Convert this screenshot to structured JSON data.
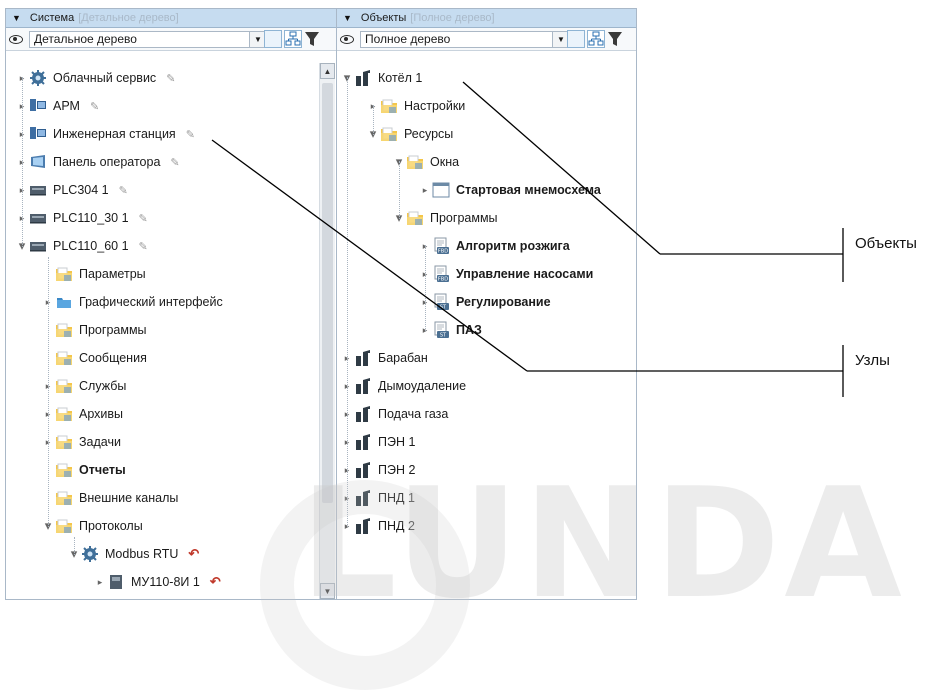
{
  "left_panel": {
    "title": "Система",
    "title_hint": "[Детальное дерево]",
    "view_select": "Детальное дерево",
    "tree": [
      {
        "label": "Облачный сервис",
        "icon": "cloud-service-icon",
        "pinned": true,
        "bold": false
      },
      {
        "label": "АРМ",
        "icon": "workstation-icon",
        "pinned": true,
        "bold": false
      },
      {
        "label": "Инженерная станция",
        "icon": "engineering-station-icon",
        "pinned": true,
        "bold": false
      },
      {
        "label": "Панель оператора",
        "icon": "operator-panel-icon",
        "pinned": true,
        "bold": false
      },
      {
        "label": "PLC304 1",
        "icon": "plc-icon",
        "pinned": true,
        "bold": false
      },
      {
        "label": "PLC110_30 1",
        "icon": "plc-icon",
        "pinned": true,
        "bold": false
      },
      {
        "label": "PLC110_60 1",
        "icon": "plc-icon",
        "pinned": true,
        "bold": false
      },
      {
        "label": "Параметры",
        "icon": "folder-parameters-icon",
        "pinned": false,
        "bold": false
      },
      {
        "label": "Графический интерфейс",
        "icon": "folder-graphics-icon",
        "pinned": false,
        "bold": false
      },
      {
        "label": "Программы",
        "icon": "folder-programs-icon",
        "pinned": false,
        "bold": false
      },
      {
        "label": "Сообщения",
        "icon": "folder-messages-icon",
        "pinned": false,
        "bold": false
      },
      {
        "label": "Службы",
        "icon": "folder-services-icon",
        "pinned": false,
        "bold": false
      },
      {
        "label": "Архивы",
        "icon": "folder-archives-icon",
        "pinned": false,
        "bold": false
      },
      {
        "label": "Задачи",
        "icon": "folder-tasks-icon",
        "pinned": false,
        "bold": false
      },
      {
        "label": "Отчеты",
        "icon": "folder-reports-icon",
        "pinned": false,
        "bold": true
      },
      {
        "label": "Внешние каналы",
        "icon": "folder-channels-icon",
        "pinned": false,
        "bold": false
      },
      {
        "label": "Протоколы",
        "icon": "folder-protocols-icon",
        "pinned": false,
        "bold": false
      },
      {
        "label": "Modbus RTU",
        "icon": "protocol-gear-icon",
        "pinned": false,
        "bold": false,
        "undo": true
      },
      {
        "label": "МУ110-8И 1",
        "icon": "io-module-icon",
        "pinned": false,
        "bold": false,
        "undo": true
      }
    ]
  },
  "right_panel": {
    "title": "Объекты",
    "title_hint": "[Полное дерево]",
    "view_select": "Полное дерево",
    "tree": [
      {
        "label": "Котёл 1",
        "icon": "plant-object-icon",
        "bold": false
      },
      {
        "label": "Настройки",
        "icon": "folder-settings-icon",
        "bold": false
      },
      {
        "label": "Ресурсы",
        "icon": "folder-resources-icon",
        "bold": false
      },
      {
        "label": "Окна",
        "icon": "folder-windows-icon",
        "bold": false
      },
      {
        "label": "Стартовая мнемосхема",
        "icon": "window-icon",
        "bold": true
      },
      {
        "label": "Программы",
        "icon": "folder-programs-icon",
        "bold": false
      },
      {
        "label": "Алгоритм розжига",
        "icon": "fbd-program-icon",
        "bold": true
      },
      {
        "label": "Управление насосами",
        "icon": "fbd-program-icon",
        "bold": true
      },
      {
        "label": "Регулирование",
        "icon": "st-program-icon",
        "bold": true
      },
      {
        "label": "ПАЗ",
        "icon": "st-program-icon",
        "bold": true
      },
      {
        "label": "Барабан",
        "icon": "plant-object-icon",
        "bold": false
      },
      {
        "label": "Дымоудаление",
        "icon": "plant-object-icon",
        "bold": false
      },
      {
        "label": "Подача газа",
        "icon": "plant-object-icon",
        "bold": false
      },
      {
        "label": "ПЭН 1",
        "icon": "plant-object-icon",
        "bold": false
      },
      {
        "label": "ПЭН 2",
        "icon": "plant-object-icon",
        "bold": false
      },
      {
        "label": "ПНД 1",
        "icon": "plant-object-icon",
        "bold": false
      },
      {
        "label": "ПНД 2",
        "icon": "plant-object-icon",
        "bold": false
      }
    ]
  },
  "callouts": {
    "objects": "Объекты",
    "nodes": "Узлы"
  },
  "watermark": "LUNDA",
  "colors": {
    "title_bar": "#c6dcf0",
    "hint_text": "#a9b9c9",
    "tree_lines": "#a8b4c0",
    "folder_yellow": "#f4c64a",
    "plc_gray": "#4f5d6b",
    "undo_red": "#c0392b"
  }
}
